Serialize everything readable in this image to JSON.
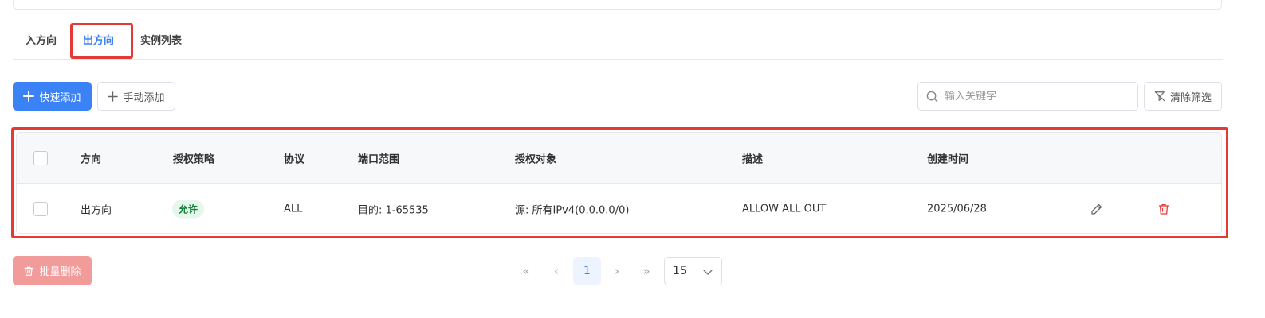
{
  "tabs": [
    {
      "label": "入方向",
      "active": false
    },
    {
      "label": "出方向",
      "active": true
    },
    {
      "label": "实例列表",
      "active": false
    }
  ],
  "toolbar": {
    "quick_add": "快速添加",
    "manual_add": "手动添加",
    "search_placeholder": "输入关键字",
    "clear_filter": "清除筛选"
  },
  "table": {
    "headers": {
      "direction": "方向",
      "policy": "授权策略",
      "protocol": "协议",
      "port_range": "端口范围",
      "target": "授权对象",
      "description": "描述",
      "created": "创建时间"
    },
    "rows": [
      {
        "direction": "出方向",
        "policy": "允许",
        "protocol": "ALL",
        "port_range": "目的: 1-65535",
        "target": "源: 所有IPv4(0.0.0.0/0)",
        "description": "ALLOW ALL OUT",
        "created": "2025/06/28"
      }
    ]
  },
  "footer": {
    "batch_delete": "批量删除",
    "pagination": {
      "first": "«",
      "prev": "‹",
      "current_page": "1",
      "next": "›",
      "last": "»",
      "page_size": "15"
    }
  },
  "colors": {
    "accent": "#3b82f6",
    "highlight_border": "#e53935",
    "danger": "#f29b9b",
    "allow_badge": "#15803d"
  },
  "icons": [
    "plus-icon",
    "search-icon",
    "filter-clear-icon",
    "edit-icon",
    "delete-icon",
    "trash-icon",
    "chevron-down-icon"
  ]
}
